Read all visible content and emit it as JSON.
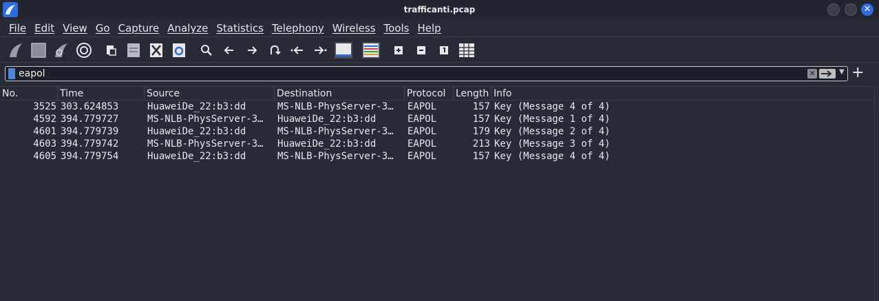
{
  "window": {
    "title": "trafficanti.pcap"
  },
  "menu": [
    "File",
    "Edit",
    "View",
    "Go",
    "Capture",
    "Analyze",
    "Statistics",
    "Telephony",
    "Wireless",
    "Tools",
    "Help"
  ],
  "toolbar": {
    "icons": [
      "shark-fin-start-icon",
      "stop-square-icon",
      "restart-fin-icon",
      "capture-options-gear-icon",
      "open-file-icon",
      "save-file-icon",
      "close-file-icon",
      "reload-icon",
      "search-icon",
      "back-arrow-icon",
      "forward-arrow-icon",
      "jump-to-icon",
      "first-packet-icon",
      "last-packet-icon",
      "autoscroll-icon",
      "colorize-icon",
      "zoom-in-icon",
      "zoom-out-icon",
      "normal-size-icon",
      "resize-columns-icon"
    ]
  },
  "filter": {
    "value": "eapol"
  },
  "columns": [
    "No.",
    "Time",
    "Source",
    "Destination",
    "Protocol",
    "Length",
    "Info"
  ],
  "packets": [
    {
      "no": "3525",
      "time": "303.624853",
      "source": "HuaweiDe_22:b3:dd",
      "destination": "MS-NLB-PhysServer-3…",
      "protocol": "EAPOL",
      "length": "157",
      "info": "Key (Message 4 of 4)"
    },
    {
      "no": "4592",
      "time": "394.779727",
      "source": "MS-NLB-PhysServer-3…",
      "destination": "HuaweiDe_22:b3:dd",
      "protocol": "EAPOL",
      "length": "157",
      "info": "Key (Message 1 of 4)"
    },
    {
      "no": "4601",
      "time": "394.779739",
      "source": "HuaweiDe_22:b3:dd",
      "destination": "MS-NLB-PhysServer-3…",
      "protocol": "EAPOL",
      "length": "179",
      "info": "Key (Message 2 of 4)"
    },
    {
      "no": "4603",
      "time": "394.779742",
      "source": "MS-NLB-PhysServer-3…",
      "destination": "HuaweiDe_22:b3:dd",
      "protocol": "EAPOL",
      "length": "213",
      "info": "Key (Message 3 of 4)"
    },
    {
      "no": "4605",
      "time": "394.779754",
      "source": "HuaweiDe_22:b3:dd",
      "destination": "MS-NLB-PhysServer-3…",
      "protocol": "EAPOL",
      "length": "157",
      "info": "Key (Message 4 of 4)"
    }
  ],
  "colors": {
    "background": "#282a35",
    "accent": "#2d6cdf"
  }
}
